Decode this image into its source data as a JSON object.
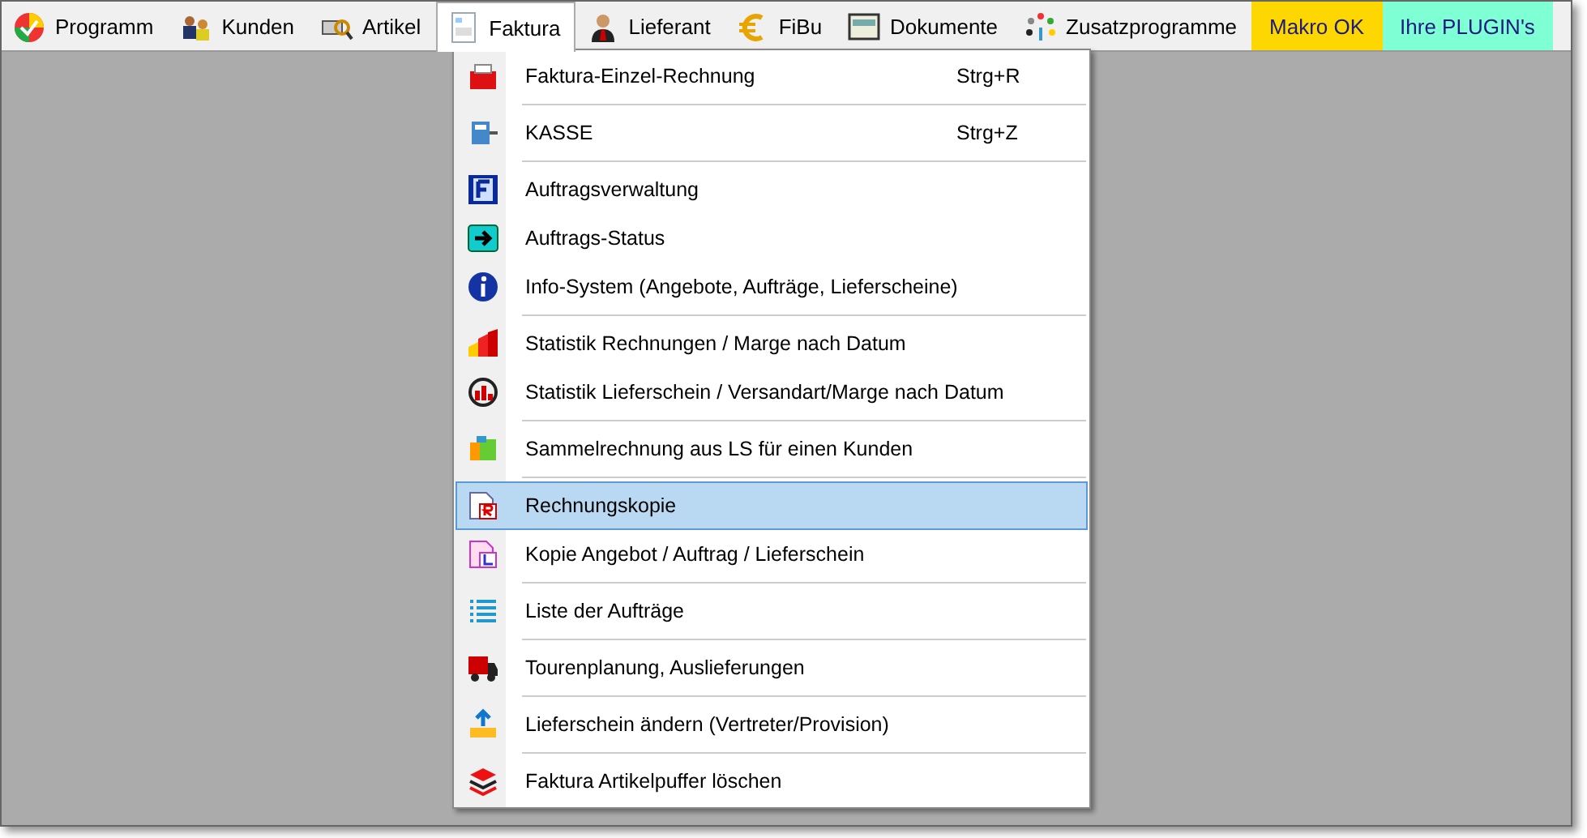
{
  "menu_bar": [
    {
      "label": "Programm",
      "kind": "menu",
      "selected": false
    },
    {
      "label": "Kunden",
      "kind": "menu",
      "selected": false
    },
    {
      "label": "Artikel",
      "kind": "menu",
      "selected": false
    },
    {
      "label": "Faktura",
      "kind": "menu",
      "selected": true
    },
    {
      "label": "Lieferant",
      "kind": "menu",
      "selected": false
    },
    {
      "label": "FiBu",
      "kind": "menu",
      "selected": false
    },
    {
      "label": "Dokumente",
      "kind": "menu",
      "selected": false
    },
    {
      "label": "Zusatzprogramme",
      "kind": "menu",
      "selected": false
    },
    {
      "label": "Makro OK",
      "kind": "button",
      "color": "#ffd700"
    },
    {
      "label": "Ihre PLUGIN's",
      "kind": "button",
      "color": "#7fffd4"
    }
  ],
  "dropdown": {
    "groups": [
      [
        {
          "label": "Faktura-Einzel-Rechnung",
          "shortcut": "Strg+R",
          "selected": false
        }
      ],
      [
        {
          "label": "KASSE",
          "shortcut": "Strg+Z",
          "selected": false
        }
      ],
      [
        {
          "label": "Auftragsverwaltung",
          "selected": false
        },
        {
          "label": "Auftrags-Status",
          "selected": false
        },
        {
          "label": "Info-System (Angebote, Aufträge, Lieferscheine)",
          "selected": false
        }
      ],
      [
        {
          "label": "Statistik Rechnungen / Marge nach Datum",
          "selected": false
        },
        {
          "label": "Statistik Lieferschein / Versandart/Marge nach Datum",
          "selected": false
        }
      ],
      [
        {
          "label": "Sammelrechnung aus LS für einen Kunden",
          "selected": false
        }
      ],
      [
        {
          "label": "Rechnungskopie",
          "selected": true
        },
        {
          "label": "Kopie Angebot / Auftrag / Lieferschein",
          "selected": false
        }
      ],
      [
        {
          "label": "Liste der Aufträge",
          "selected": false
        }
      ],
      [
        {
          "label": "Tourenplanung, Auslieferungen",
          "selected": false
        }
      ],
      [
        {
          "label": "Lieferschein ändern (Vertreter/Provision)",
          "selected": false
        }
      ],
      [
        {
          "label": "Faktura Artikelpuffer löschen",
          "selected": false
        }
      ]
    ]
  }
}
